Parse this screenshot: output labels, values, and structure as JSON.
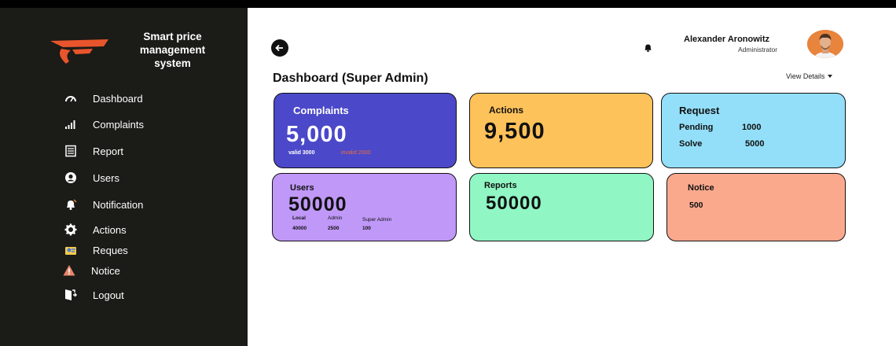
{
  "brand": {
    "line1": "Smart price",
    "line2": "management",
    "line3": "system",
    "accent": "#e8552c"
  },
  "nav": [
    {
      "label": "Dashboard",
      "icon": "gauge-icon"
    },
    {
      "label": "Complaints",
      "icon": "signal-bars-icon"
    },
    {
      "label": "Report",
      "icon": "document-icon"
    },
    {
      "label": "Users",
      "icon": "user-circle-icon"
    },
    {
      "label": "Notification",
      "icon": "bell-icon"
    },
    {
      "label": "Actions",
      "icon": "gear-icon"
    },
    {
      "label": "Reques",
      "icon": "request-icon"
    },
    {
      "label": "Notice",
      "icon": "warning-icon"
    },
    {
      "label": "Logout",
      "icon": "logout-icon"
    }
  ],
  "header": {
    "user_name": "Alexander Aronowitz",
    "user_role": "Administrator",
    "page_title": "Dashboard (Super Admin)",
    "view_details": "View Details"
  },
  "cards": {
    "complaints": {
      "title": "Complaints",
      "value": "5,000",
      "valid": "valid 3000",
      "invalid": "invalid 2000",
      "color": "#4b48c9"
    },
    "actions": {
      "title": "Actions",
      "value": "9,500",
      "color": "#fec25a"
    },
    "request": {
      "title": "Request",
      "pending_label": "Pending",
      "pending_value": "1000",
      "solve_label": "Solve",
      "solve_value": "5000",
      "color": "#93dff9"
    },
    "users": {
      "title": "Users",
      "value": "50000",
      "local_label": "Local",
      "admin_label": "Admin",
      "super_label": "Super Admin",
      "local_value": "40000",
      "admin_value": "2500",
      "super_value": "100",
      "color": "#c098f8"
    },
    "reports": {
      "title": "Reports",
      "value": "50000",
      "color": "#90f6c4"
    },
    "notice": {
      "title": "Notice",
      "value": "500",
      "color": "#fba98d"
    }
  }
}
